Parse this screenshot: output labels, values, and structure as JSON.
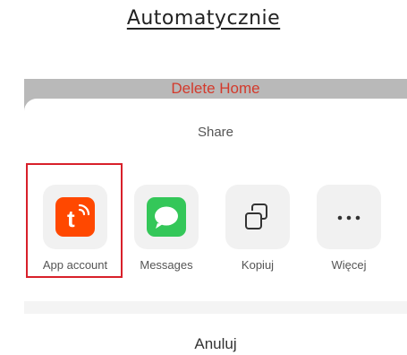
{
  "page": {
    "title": "Automatycznie"
  },
  "background_sheet": {
    "action_label": "Delete Home",
    "action_color": "#d33a2c"
  },
  "share_sheet": {
    "title": "Share",
    "items": [
      {
        "label": "App account",
        "icon": "tuya-smart-app-icon",
        "icon_bg": "#ff4800"
      },
      {
        "label": "Messages",
        "icon": "messages-icon",
        "icon_bg": "#34c759"
      },
      {
        "label": "Kopiuj",
        "icon": "copy-icon"
      },
      {
        "label": "Więcej",
        "icon": "more-icon"
      }
    ],
    "cancel_label": "Anuluj"
  },
  "annotation": {
    "highlighted_item": "App account",
    "color": "#d8202a"
  }
}
